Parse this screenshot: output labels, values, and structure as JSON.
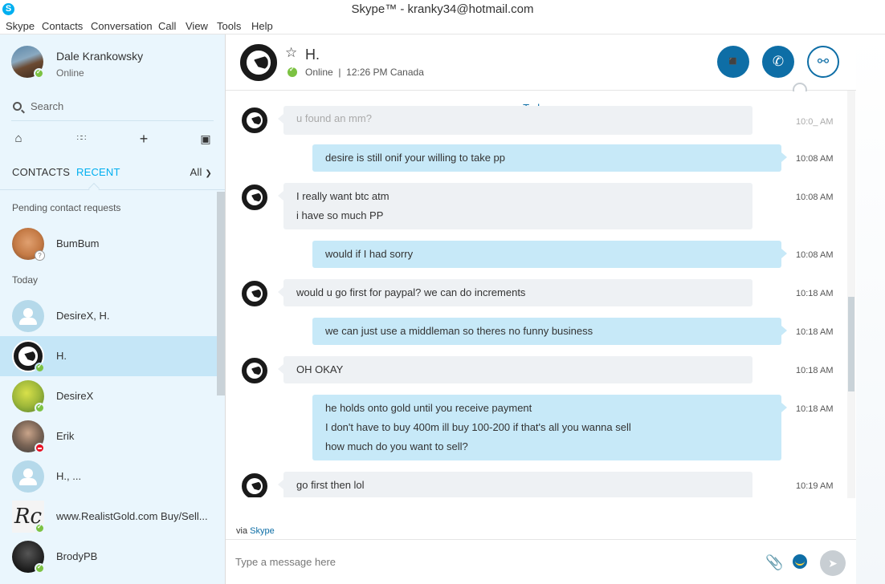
{
  "window": {
    "title": "Skype™ - kranky34@hotmail.com"
  },
  "menu": [
    "Skype",
    "Contacts",
    "Conversation",
    "Call",
    "View",
    "Tools",
    "Help"
  ],
  "me": {
    "name": "Dale Krankowsky",
    "status": "Online"
  },
  "search": {
    "placeholder": "Search"
  },
  "tabs": {
    "contacts": "CONTACTS",
    "recent": "RECENT",
    "filter": "All"
  },
  "sections": {
    "pending": "Pending contact requests",
    "today": "Today"
  },
  "contacts": [
    {
      "name": "BumBum",
      "status": "pending"
    },
    {
      "name": "DesireX, H.",
      "status": "group"
    },
    {
      "name": "H.",
      "status": "online",
      "active": true
    },
    {
      "name": "DesireX",
      "status": "online"
    },
    {
      "name": "Erik",
      "status": "dnd"
    },
    {
      "name": "H., ...",
      "status": "group"
    },
    {
      "name": "www.RealistGold.com Buy/Sell...",
      "status": "online"
    },
    {
      "name": "BrodyPB",
      "status": "online"
    }
  ],
  "chat": {
    "name": "H.",
    "status": "Online",
    "local_time": "12:26 PM Canada",
    "day_label": "Today",
    "messages": [
      {
        "dir": "in",
        "lines": [
          "u found an mm?"
        ],
        "time": "10:0_ AM"
      },
      {
        "dir": "out",
        "lines": [
          "desire is still onif your willing to take pp"
        ],
        "time": "10:08 AM"
      },
      {
        "dir": "in",
        "lines": [
          "I really want btc atm",
          "i have so much PP"
        ],
        "time": "10:08 AM"
      },
      {
        "dir": "out",
        "lines": [
          "would if I had sorry"
        ],
        "time": "10:08 AM"
      },
      {
        "dir": "in",
        "lines": [
          "would u go first for paypal? we can do increments"
        ],
        "time": "10:18 AM"
      },
      {
        "dir": "out",
        "lines": [
          "we can just use a middleman so theres no funny business"
        ],
        "time": "10:18 AM"
      },
      {
        "dir": "in",
        "lines": [
          "OH OKAY"
        ],
        "time": "10:18 AM"
      },
      {
        "dir": "out",
        "lines": [
          "he holds onto gold until you receive payment",
          "I don't have to buy 400m ill buy 100-200 if that's all you wanna sell",
          "how much do you want to sell?"
        ],
        "time": "10:18 AM"
      },
      {
        "dir": "in",
        "lines": [
          "go first then lol"
        ],
        "time": "10:19 AM"
      }
    ]
  },
  "composer": {
    "via_prefix": "via",
    "via_link": "Skype",
    "placeholder": "Type a message here"
  },
  "colors": {
    "accent": "#00aff0",
    "button": "#0e6ea6",
    "sidebar_bg": "#eaf6fd",
    "outgoing_bubble": "#c7e9f8",
    "incoming_bubble": "#eef1f4",
    "online": "#7cc242",
    "dnd": "#e81123"
  }
}
